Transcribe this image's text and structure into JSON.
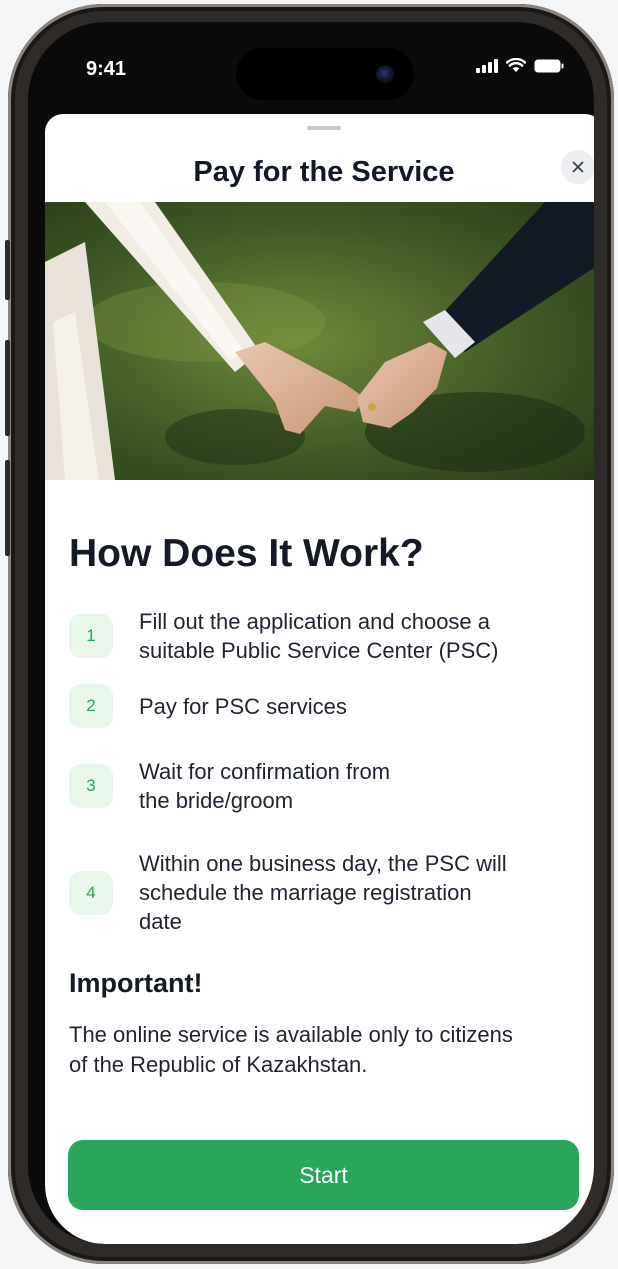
{
  "status_bar": {
    "time": "9:41",
    "icons": [
      "signal-icon",
      "wifi-icon",
      "battery-icon"
    ]
  },
  "sheet": {
    "title": "Pay for the Service",
    "close_icon": "close-icon",
    "hero_image": "photo of bride and groom holding hands"
  },
  "how": {
    "heading": "How Does It Work?",
    "steps": [
      {
        "number": "1",
        "lines": [
          "Fill out the application and choose a",
          "suitable Public Service Center (PSC)"
        ]
      },
      {
        "number": "2",
        "lines": [
          "Pay for PSC services"
        ]
      },
      {
        "number": "3",
        "lines": [
          "Wait for confirmation from",
          "the bride/groom"
        ]
      },
      {
        "number": "4",
        "lines": [
          "Within one business day, the PSC will",
          "schedule the marriage registration",
          "date"
        ]
      }
    ]
  },
  "important": {
    "title": "Important!",
    "lines": [
      "The online service is available only to citizens",
      "of the Republic of Kazakhstan."
    ]
  },
  "actions": {
    "start_label": "Start"
  },
  "colors": {
    "accent": "#2aa65a",
    "badge_bg": "#e8f6ec",
    "text": "#141a26"
  }
}
